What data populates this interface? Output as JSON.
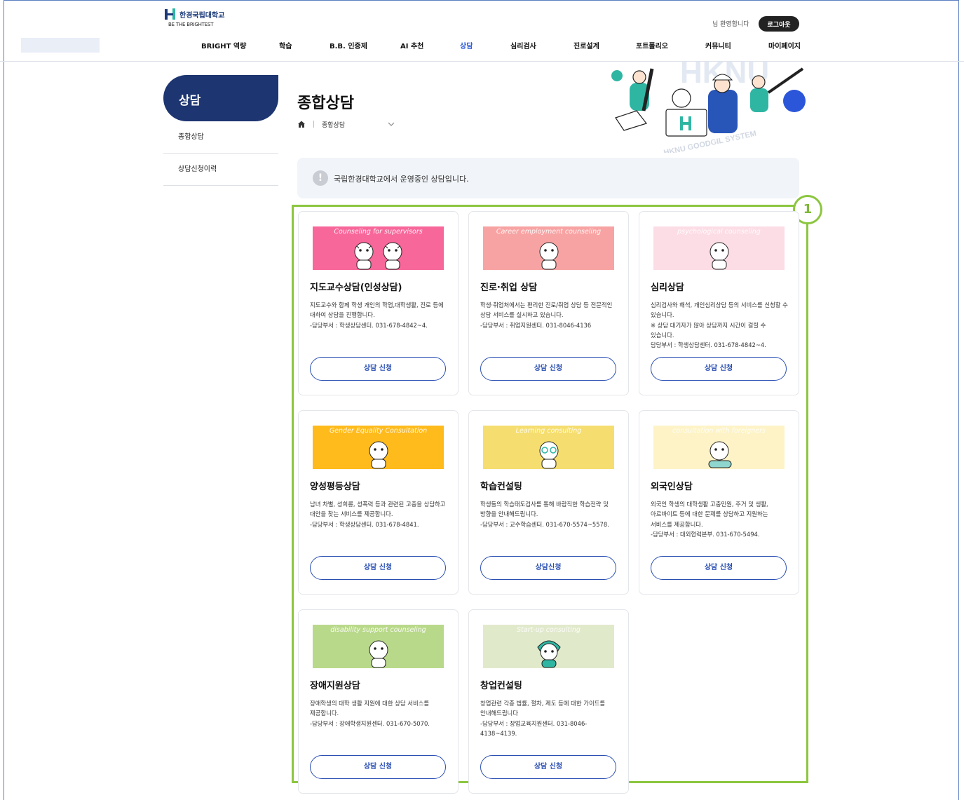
{
  "header": {
    "logo_name": "한경국립대학교",
    "logo_sub": "BE THE BRIGHTEST",
    "welcome": "님 환영합니다",
    "logout_label": "로그아웃",
    "nav": [
      "BRIGHT 역량",
      "학습",
      "B.B. 인증제",
      "AI 추천",
      "상담",
      "심리검사",
      "진로설계",
      "포트폴리오",
      "커뮤니티",
      "마이페이지"
    ],
    "active_nav": "상담"
  },
  "sidebar": {
    "title": "상담",
    "items": [
      {
        "label": "종합상담"
      },
      {
        "label": "상담신청이력"
      }
    ]
  },
  "page": {
    "title": "종합상담",
    "breadcrumb": "종합상담",
    "hero_text": "HKNU GOODGIL SYSTEM",
    "hero_big": "HKNU",
    "notice_icon": "!",
    "notice": "국립한경대학교에서 운영중인 상담입니다."
  },
  "highlight_badge": "1",
  "cards": [
    {
      "eng": "Counseling for supervisors",
      "color": "#f7679a",
      "title": "지도교수상담(인성상담)",
      "desc": "지도교수와 함께 학생 개인의 학업,대학생활, 진로 등에 대하여 상담을 진행합니다.\n-담당부서 : 학생상담센터. 031-678-4842~4.",
      "button": "상담 신청",
      "icon": "tiger-pair-icon"
    },
    {
      "eng": "Career employment counseling",
      "color": "#f8a3a3",
      "title": "진로·취업 상담",
      "desc": "학생·취업처에서는 편리한 진로/취업 상담 등 전문적인 상담 서비스를 실시하고 있습니다.\n-담당부서 : 취업지원센터. 031-8046-4136",
      "button": "상담 신청",
      "icon": "tiger-career-icon"
    },
    {
      "eng": "psychological counseling",
      "color": "#fcdde6",
      "title": "심리상담",
      "desc": "심리검사와 해석, 개인심리상담 등의 서비스를 신청할 수 있습니다.\n※ 상담 대기자가 많아 상담까지 시간이 걸릴 수 있습니다.\n담당부서 : 학생상담센터. 031-678-4842~4.",
      "button": "상담 신청",
      "icon": "tiger-thinking-icon"
    },
    {
      "eng": "Gender Equality Consultation",
      "color": "#ffbb1c",
      "title": "양성평등상담",
      "desc": "남녀 차별, 성희롱, 성폭력 등과 관련된 고충을 상담하고 대안을 찾는 서비스를 제공합니다.\n-담당부서 : 학생상담센터. 031-678-4841.",
      "button": "상담 신청",
      "icon": "tiger-heart-icon"
    },
    {
      "eng": "Learning consulting",
      "color": "#f5de6f",
      "title": "학습컨설팅",
      "desc": "학생들의 학습태도검사를 통해 바람직한 학습전략 및 방향을 안내해드립니다.\n-담당부서 : 교수학습센터. 031-670-5574~5578.",
      "button": "상담신청",
      "icon": "tiger-glasses-icon"
    },
    {
      "eng": "consultation with foreigners",
      "color": "#fdf3c6",
      "title": "외국인상담",
      "desc": "외국인 학생의 대학생활 고충민원, 주거 및 생활, 아르바이트 등에 대한 문제를 상담하고 지원하는 서비스를 제공합니다.\n-담당부서 : 대외협력본부. 031-670-5494.",
      "button": "상담 신청",
      "icon": "tiger-plane-icon"
    },
    {
      "eng": "disability support counseling",
      "color": "#b9d98a",
      "title": "장애지원상담",
      "desc": "장애학생의 대학 생활 지원에 대한 상담 서비스를 제공합니다.\n-담당부서 : 장애학생지원센터. 031-670-5070.",
      "button": "상담 신청",
      "icon": "tiger-support-icon"
    },
    {
      "eng": "Start-up consulting",
      "color": "#e1e9cb",
      "title": "창업컨설팅",
      "desc": "창업관련 각종 법률, 절차, 제도 등에 대한 가이드를 안내해드립니다\n-담당부서 : 창업교육지원센터. 031-8046-4138~4139.",
      "button": "상담 신청",
      "icon": "tiger-startup-icon"
    }
  ]
}
